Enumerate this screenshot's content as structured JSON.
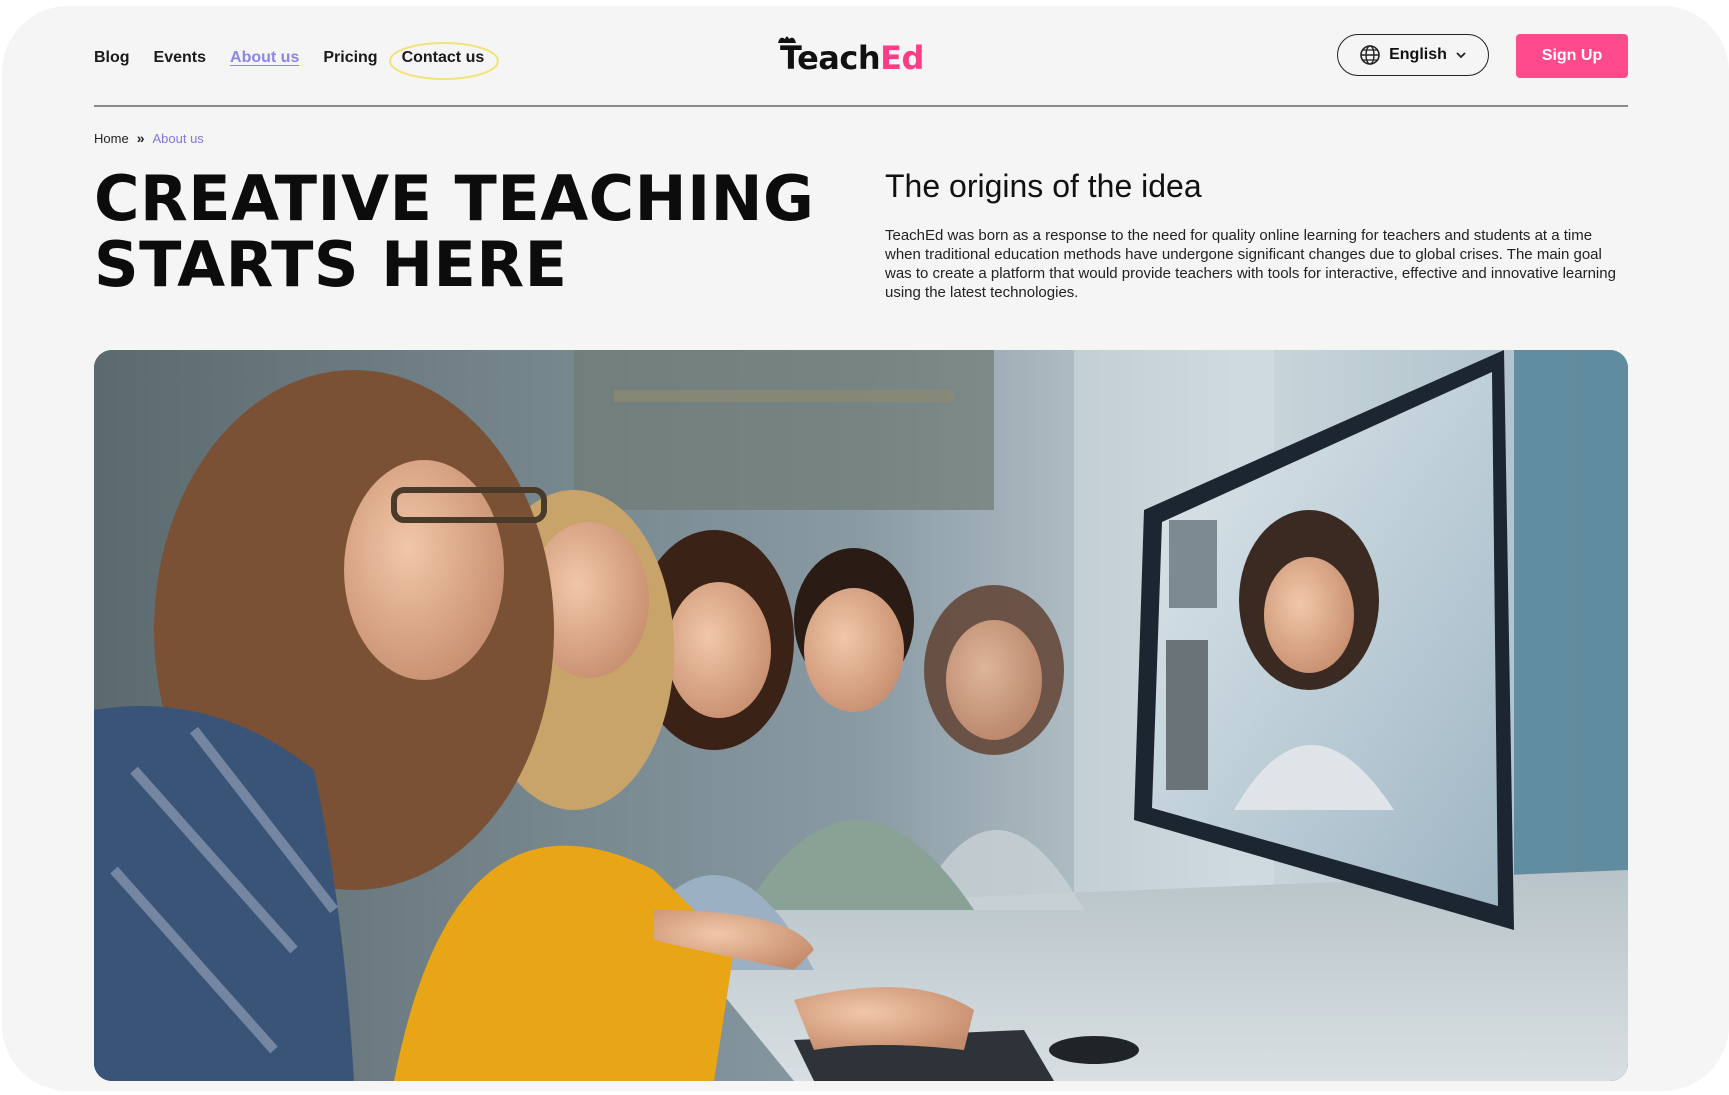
{
  "nav": {
    "items": [
      {
        "label": "Blog"
      },
      {
        "label": "Events"
      },
      {
        "label": "About us"
      },
      {
        "label": "Pricing"
      },
      {
        "label": "Contact us"
      }
    ],
    "active": "About us"
  },
  "brand": {
    "part1": "Teach",
    "part2": "Ed"
  },
  "language": {
    "label": "English",
    "icon": "globe-icon"
  },
  "signup": {
    "label": "Sign Up"
  },
  "breadcrumb": {
    "home": "Home",
    "separator": "»",
    "current": "About us"
  },
  "hero": {
    "headline_line1": "CREATIVE TEACHING",
    "headline_line2": "STARTS HERE",
    "subheading": "The origins of the idea",
    "description": "TeachEd was born as a response to the need for quality online learning for teachers and students at a time when traditional education methods have undergone significant changes due to global crises. The main goal was to create a platform that would provide teachers with tools for interactive, effective and innovative learning using the latest technologies."
  },
  "colors": {
    "accent_pink": "#ff4b8b",
    "accent_purple": "#8b86e8",
    "background": "#f5f5f5",
    "text": "#111111"
  }
}
